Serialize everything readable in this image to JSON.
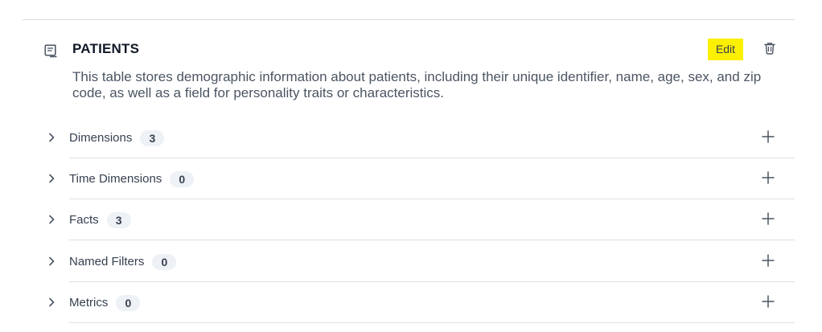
{
  "header": {
    "title": "PATIENTS",
    "edit_label": "Edit",
    "description": "This table stores demographic information about patients, including their unique identifier, name, age, sex, and zip code, as well as a field for personality traits or characteristics."
  },
  "icons": {
    "table": "table-icon",
    "delete": "trash-icon",
    "expand": "chevron-right-icon",
    "add": "plus-icon"
  },
  "colors": {
    "edit_highlight": "#fbf000",
    "badge_background": "#eef1f5",
    "divider": "#dcdfe4"
  },
  "sections": [
    {
      "label": "Dimensions",
      "count": "3"
    },
    {
      "label": "Time Dimensions",
      "count": "0"
    },
    {
      "label": "Facts",
      "count": "3"
    },
    {
      "label": "Named Filters",
      "count": "0"
    },
    {
      "label": "Metrics",
      "count": "0"
    }
  ]
}
